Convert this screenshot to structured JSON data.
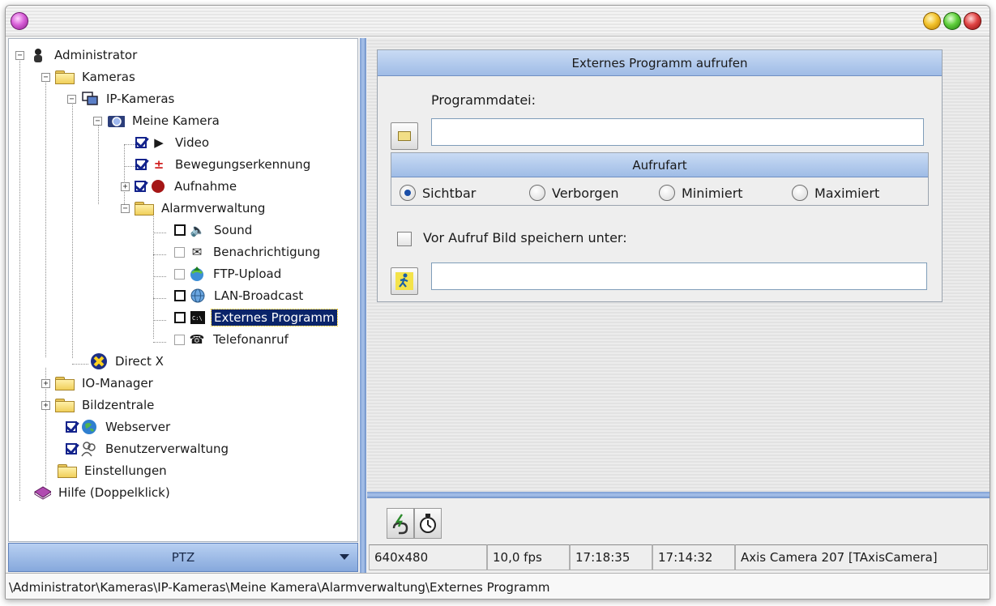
{
  "tree": {
    "items": [
      {
        "label": "Administrator"
      },
      {
        "label": "Kameras"
      },
      {
        "label": "IP-Kameras"
      },
      {
        "label": "Meine Kamera"
      },
      {
        "label": "Video"
      },
      {
        "label": "Bewegungserkennung"
      },
      {
        "label": "Aufnahme"
      },
      {
        "label": "Alarmverwaltung"
      },
      {
        "label": "Sound"
      },
      {
        "label": "Benachrichtigung"
      },
      {
        "label": "FTP-Upload"
      },
      {
        "label": "LAN-Broadcast"
      },
      {
        "label": "Externes Programm"
      },
      {
        "label": "Telefonanruf"
      },
      {
        "label": "Direct X"
      },
      {
        "label": "IO-Manager"
      },
      {
        "label": "Bildzentrale"
      },
      {
        "label": "Webserver"
      },
      {
        "label": "Benutzerverwaltung"
      },
      {
        "label": "Einstellungen"
      },
      {
        "label": "Hilfe (Doppelklick)"
      }
    ],
    "selected": "Externes Programm"
  },
  "ptz": {
    "label": "PTZ"
  },
  "panel": {
    "title": "Externes Programm aufrufen",
    "program_label": "Programmdatei:",
    "program_value": "",
    "call_type": {
      "title": "Aufrufart",
      "options": [
        "Sichtbar",
        "Verborgen",
        "Minimiert",
        "Maximiert"
      ],
      "selected": "Sichtbar"
    },
    "save_before": {
      "label": "Vor Aufruf Bild speichern unter:",
      "checked": false,
      "value": ""
    }
  },
  "toolbar": {
    "icons": [
      "link-icon",
      "stopwatch-icon"
    ]
  },
  "status": {
    "resolution": "640x480",
    "fps": "10,0 fps",
    "time1": "17:18:35",
    "time2": "17:14:32",
    "camera": "Axis Camera 207 [TAxisCamera]"
  },
  "path": "\\Administrator\\Kameras\\IP-Kameras\\Meine Kamera\\Alarmverwaltung\\Externes Programm",
  "colors": {
    "accent": "#0a246a",
    "header": "#9fbce6",
    "splitter": "#7e9fd3"
  }
}
